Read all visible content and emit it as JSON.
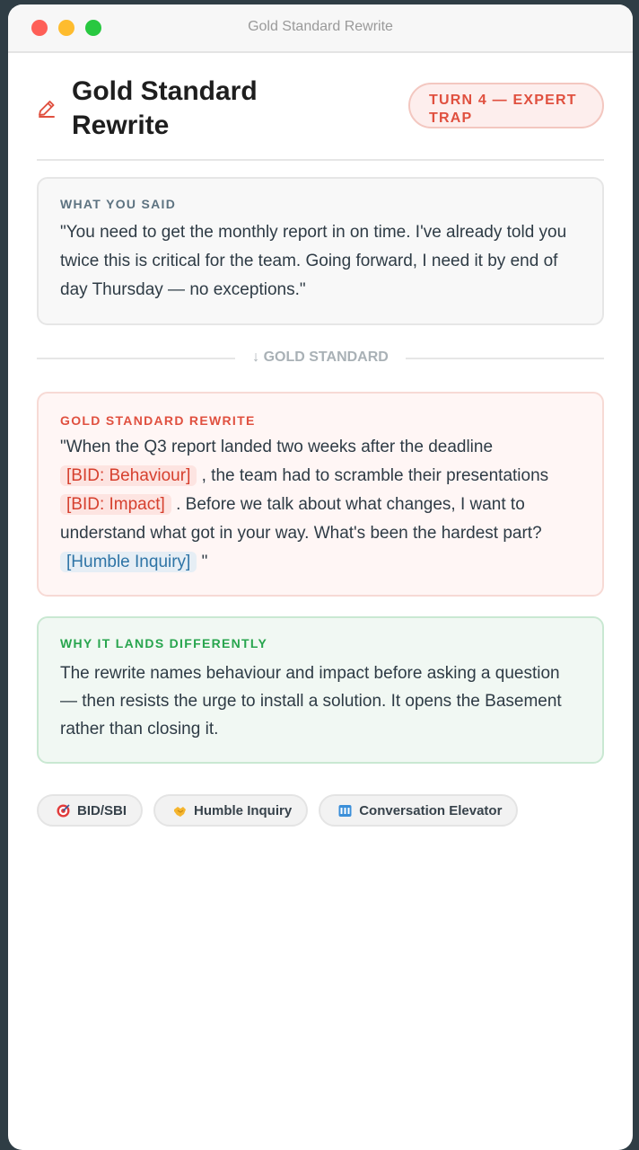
{
  "window": {
    "title": "Gold Standard Rewrite"
  },
  "header": {
    "title": "Gold Standard Rewrite",
    "badge": "TURN 4 — EXPERT TRAP",
    "icon": "pencil-icon"
  },
  "what_you_said": {
    "label": "WHAT YOU SAID",
    "text": "\"You need to get the monthly report in on time. I've already told you twice this is critical for the team. Going forward, I need it by end of day Thursday — no exceptions.\""
  },
  "divider": {
    "label": "↓ GOLD STANDARD"
  },
  "rewrite": {
    "label": "GOLD STANDARD REWRITE",
    "segments": [
      {
        "text": "\"When the Q3 report landed two weeks after the deadline "
      },
      {
        "tag": "[BID: Behaviour]"
      },
      {
        "text": " , the team had to scramble their presentations "
      },
      {
        "tag": "[BID: Impact]"
      },
      {
        "text": " . Before we talk about what changes, I want to understand what got in your way. What's been the hardest part? "
      },
      {
        "tag": "[Humble Inquiry]"
      },
      {
        "text": " \""
      }
    ]
  },
  "why": {
    "label": "WHY IT LANDS DIFFERENTLY",
    "text": "The rewrite names behaviour and impact before asking a question — then resists the urge to install a solution. It opens the Basement rather than closing it."
  },
  "chips": [
    {
      "label": "BID/SBI",
      "icon": "target-icon"
    },
    {
      "label": "Humble Inquiry",
      "icon": "handshake-icon"
    },
    {
      "label": "Conversation Elevator",
      "icon": "elevator-icon"
    }
  ],
  "colors": {
    "accent": "#e0503f",
    "success": "#28a54e",
    "inquiry": "#2e74a6"
  }
}
